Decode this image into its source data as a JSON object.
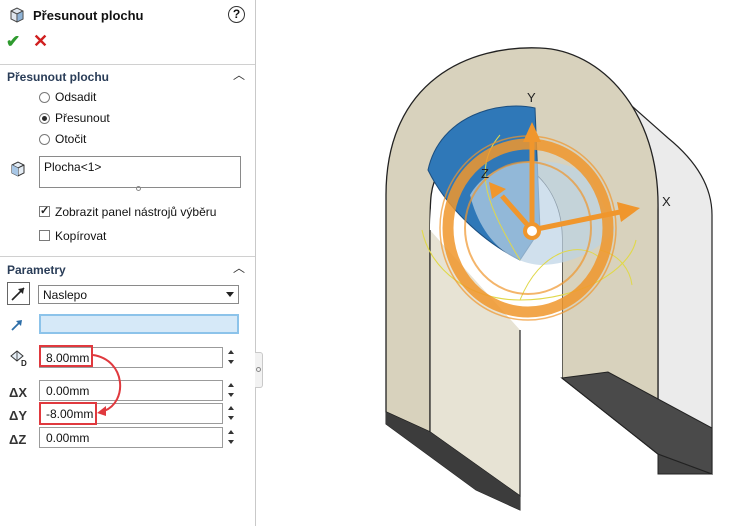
{
  "header": {
    "title": "Přesunout plochu",
    "help_icon": "help-icon"
  },
  "actions": {
    "ok_icon": "check-icon",
    "cancel_icon": "close-icon"
  },
  "section_move": {
    "title": "Přesunout plochu",
    "options": [
      {
        "label": "Odsadit",
        "selected": false
      },
      {
        "label": "Přesunout",
        "selected": true
      },
      {
        "label": "Otočit",
        "selected": false
      }
    ],
    "selection": "Plocha<1>",
    "show_toolbar": {
      "label": "Zobrazit panel nástrojů výběru",
      "checked": true
    },
    "copy": {
      "label": "Kopírovat",
      "checked": false
    }
  },
  "section_params": {
    "title": "Parametry",
    "end_condition": "Naslepo",
    "reference": "",
    "distance": "8.00mm",
    "dx": {
      "label": "ΔX",
      "value": "0.00mm"
    },
    "dy": {
      "label": "ΔY",
      "value": "-8.00mm"
    },
    "dz": {
      "label": "ΔZ",
      "value": "0.00mm"
    }
  },
  "viewport": {
    "axes": {
      "x": "X",
      "y": "Y",
      "z": "Z"
    },
    "colors": {
      "triad": "#f0962c",
      "ring": "#f0962c",
      "face": "#2f78b8",
      "body": "#d8d2bd",
      "callout": "#e0393e"
    }
  }
}
